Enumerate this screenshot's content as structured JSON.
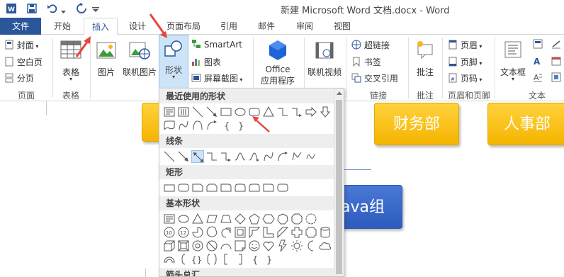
{
  "window": {
    "title": "新建 Microsoft Word 文档.docx - Word"
  },
  "tabs": [
    "文件",
    "开始",
    "插入",
    "设计",
    "页面布局",
    "引用",
    "邮件",
    "审阅",
    "视图"
  ],
  "ribbon": {
    "pages": {
      "cover": "封面",
      "blank": "空白页",
      "break": "分页",
      "group": "页面"
    },
    "tables": {
      "table": "表格",
      "group": "表格"
    },
    "illustrations": {
      "picture": "图片",
      "online_picture": "联机图片",
      "shapes": "形状",
      "smartart": "SmartArt",
      "chart": "图表",
      "screenshot": "屏幕截图"
    },
    "apps": {
      "office": "Office",
      "office2": "应用程序"
    },
    "media": {
      "online_video": "联机视频"
    },
    "links": {
      "hyperlink": "超链接",
      "bookmark": "书签",
      "crossref": "交叉引用",
      "group": "链接"
    },
    "comments": {
      "comment": "批注",
      "group": "批注"
    },
    "header_footer": {
      "header": "页眉",
      "footer": "页脚",
      "page_number": "页码",
      "group": "页眉和页脚"
    },
    "text": {
      "textbox": "文本框",
      "group": "文本"
    }
  },
  "shapes_menu": {
    "sections": [
      "最近使用的形状",
      "线条",
      "矩形",
      "基本形状",
      "箭头总汇"
    ]
  },
  "document": {
    "boxes": {
      "finance": "财务部",
      "hr": "人事部",
      "java": "Java组"
    }
  }
}
